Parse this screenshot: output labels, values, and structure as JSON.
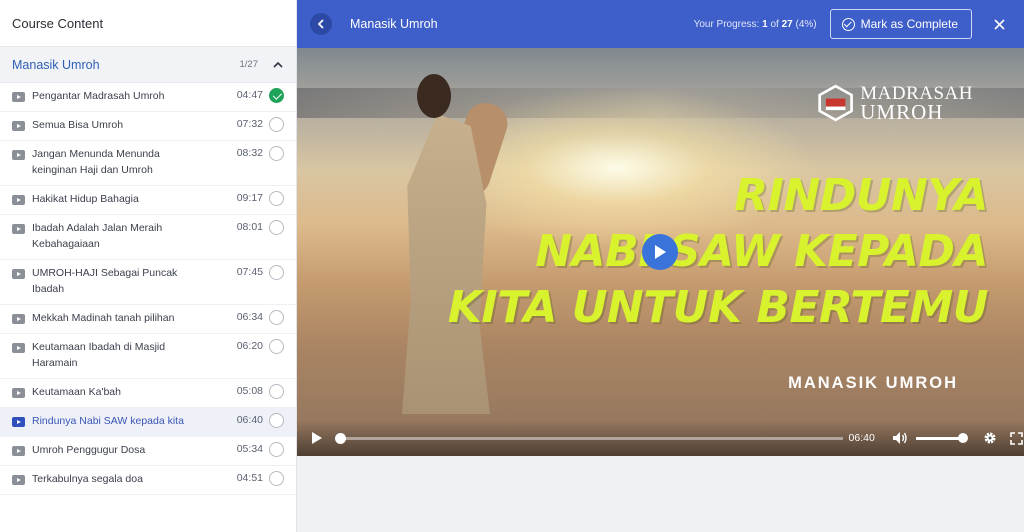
{
  "sidebar": {
    "title": "Course Content",
    "topic": {
      "title": "Manasik Umroh",
      "count": "1/27"
    },
    "lessons": [
      {
        "title": "Pengantar Madrasah Umroh",
        "duration": "04:47",
        "completed": true,
        "active": false
      },
      {
        "title": "Semua Bisa Umroh",
        "duration": "07:32",
        "completed": false,
        "active": false
      },
      {
        "title": "Jangan Menunda Menunda keinginan Haji dan Umroh",
        "duration": "08:32",
        "completed": false,
        "active": false
      },
      {
        "title": "Hakikat Hidup Bahagia",
        "duration": "09:17",
        "completed": false,
        "active": false
      },
      {
        "title": "Ibadah Adalah Jalan Meraih Kebahagaiaan",
        "duration": "08:01",
        "completed": false,
        "active": false
      },
      {
        "title": "UMROH-HAJI Sebagai Puncak Ibadah",
        "duration": "07:45",
        "completed": false,
        "active": false
      },
      {
        "title": "Mekkah Madinah tanah pilihan",
        "duration": "06:34",
        "completed": false,
        "active": false
      },
      {
        "title": "Keutamaan Ibadah di Masjid Haramain",
        "duration": "06:20",
        "completed": false,
        "active": false
      },
      {
        "title": "Keutamaan Ka'bah",
        "duration": "05:08",
        "completed": false,
        "active": false
      },
      {
        "title": "Rindunya Nabi SAW kepada kita",
        "duration": "06:40",
        "completed": false,
        "active": true
      },
      {
        "title": "Umroh Penggugur Dosa",
        "duration": "05:34",
        "completed": false,
        "active": false
      },
      {
        "title": "Terkabulnya segala doa",
        "duration": "04:51",
        "completed": false,
        "active": false
      }
    ]
  },
  "header": {
    "course_title": "Manasik Umroh",
    "progress_label": "Your Progress:",
    "progress_current": "1",
    "progress_of": "of",
    "progress_total": "27",
    "progress_percent": "(4%)",
    "complete_button": "Mark as Complete",
    "accent_color": "#3e5ec9"
  },
  "video": {
    "logo_line1": "MADRASAH",
    "logo_line2": "UMROH",
    "headline_line1": "RINDUNYA",
    "headline_line2": "NABI SAW KEPADA",
    "headline_line3": "KITA UNTUK BERTEMU",
    "subtitle": "MANASIK UMROH",
    "time": "06:40",
    "playback_progress": 0,
    "volume_level": 1.0,
    "headline_color": "#d8f22d"
  }
}
